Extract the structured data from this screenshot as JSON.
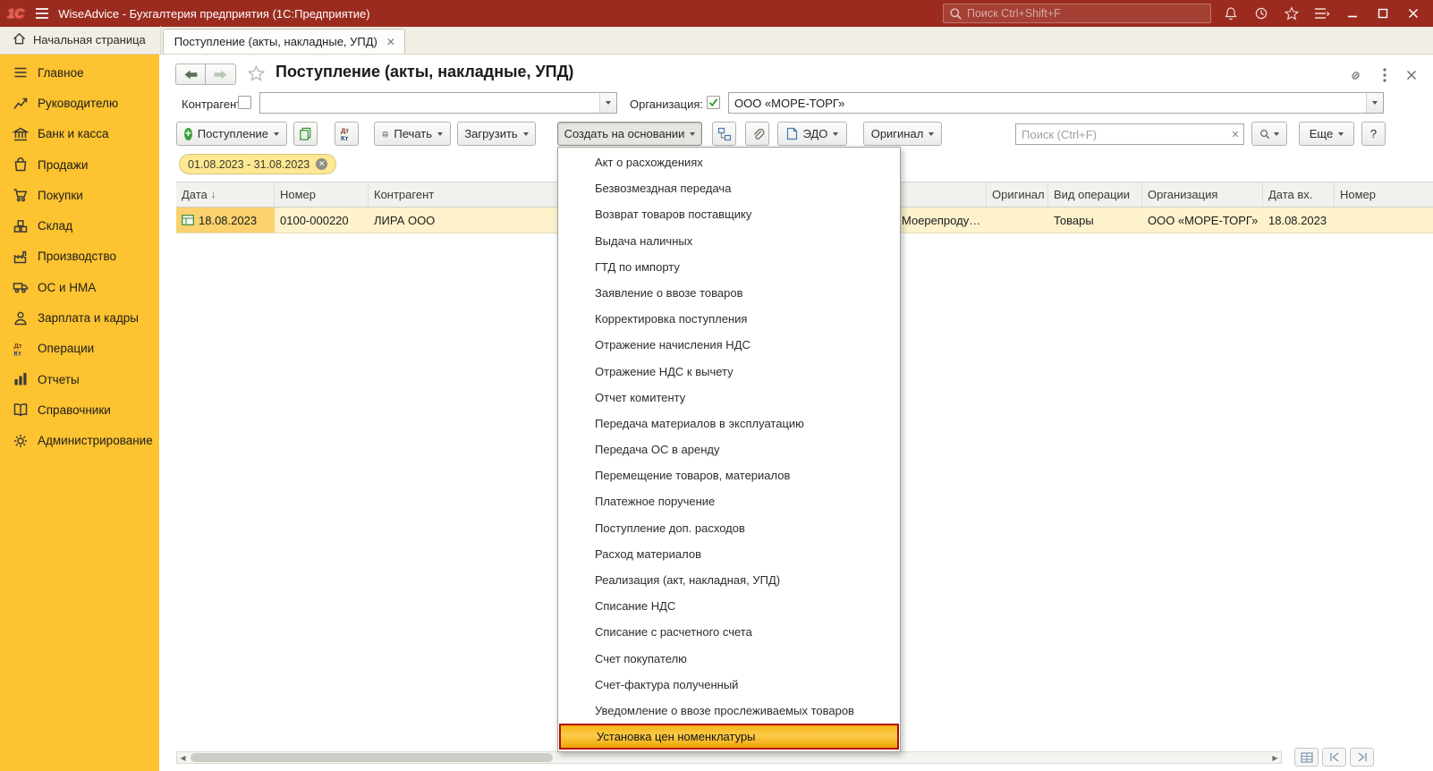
{
  "titlebar": {
    "logo": "1С",
    "title": "WiseAdvice - Бухгалтерия предприятия  (1С:Предприятие)",
    "search_placeholder": "Поиск Ctrl+Shift+F"
  },
  "tabbar": {
    "home_label": "Начальная страница",
    "active_tab": "Поступление (акты, накладные, УПД)"
  },
  "sidebar": {
    "items": [
      {
        "label": "Главное",
        "icon": "menu"
      },
      {
        "label": "Руководителю",
        "icon": "chart"
      },
      {
        "label": "Банк и касса",
        "icon": "bank"
      },
      {
        "label": "Продажи",
        "icon": "bag"
      },
      {
        "label": "Покупки",
        "icon": "cart"
      },
      {
        "label": "Склад",
        "icon": "boxes"
      },
      {
        "label": "Производство",
        "icon": "factory"
      },
      {
        "label": "ОС и НМА",
        "icon": "truck"
      },
      {
        "label": "Зарплата и кадры",
        "icon": "person"
      },
      {
        "label": "Операции",
        "icon": "dtkt"
      },
      {
        "label": "Отчеты",
        "icon": "report"
      },
      {
        "label": "Справочники",
        "icon": "book"
      },
      {
        "label": "Администрирование",
        "icon": "gear"
      }
    ]
  },
  "page": {
    "title": "Поступление (акты, накладные, УПД)",
    "kontragent_label": "Контрагент:",
    "kontragent_value": "",
    "org_label": "Организация:",
    "org_value": "ООО «МОРЕ-ТОРГ»",
    "period_chip": "01.08.2023 - 31.08.2023"
  },
  "toolbar": {
    "postuplenie": "Поступление",
    "print": "Печать",
    "load": "Загрузить",
    "create_based_on": "Создать на основании",
    "edo": "ЭДО",
    "original": "Оригинал",
    "search_placeholder": "Поиск (Ctrl+F)",
    "more": "Еще",
    "help": "?"
  },
  "table": {
    "headers": [
      "Дата",
      "Номер",
      "Контрагент",
      "",
      "Оригинал",
      "Вид операции",
      "Организация",
      "Дата вх.",
      "Номер"
    ],
    "sort_icon": "↓",
    "row": {
      "date": "18.08.2023",
      "number": "0100-000220",
      "kontragent": "ЛИРА ООО",
      "partial": "Моерепроду…",
      "original": "",
      "operation": "Товары",
      "org": "ООО «МОРЕ-ТОРГ»",
      "date_in": "18.08.2023",
      "number2": ""
    }
  },
  "context_menu": {
    "items": [
      "Акт о расхождениях",
      "Безвозмездная передача",
      "Возврат товаров поставщику",
      "Выдача наличных",
      "ГТД по импорту",
      "Заявление о ввозе товаров",
      "Корректировка поступления",
      "Отражение начисления НДС",
      "Отражение НДС к вычету",
      "Отчет комитенту",
      "Передача материалов в эксплуатацию",
      "Передача ОС в аренду",
      "Перемещение товаров, материалов",
      "Платежное поручение",
      "Поступление доп. расходов",
      "Расход материалов",
      "Реализация (акт, накладная, УПД)",
      "Списание НДС",
      "Списание с расчетного счета",
      "Счет покупателю",
      "Счет-фактура полученный",
      "Уведомление о ввозе прослеживаемых товаров",
      "Установка цен номенклатуры"
    ],
    "highlighted_index": 22
  }
}
